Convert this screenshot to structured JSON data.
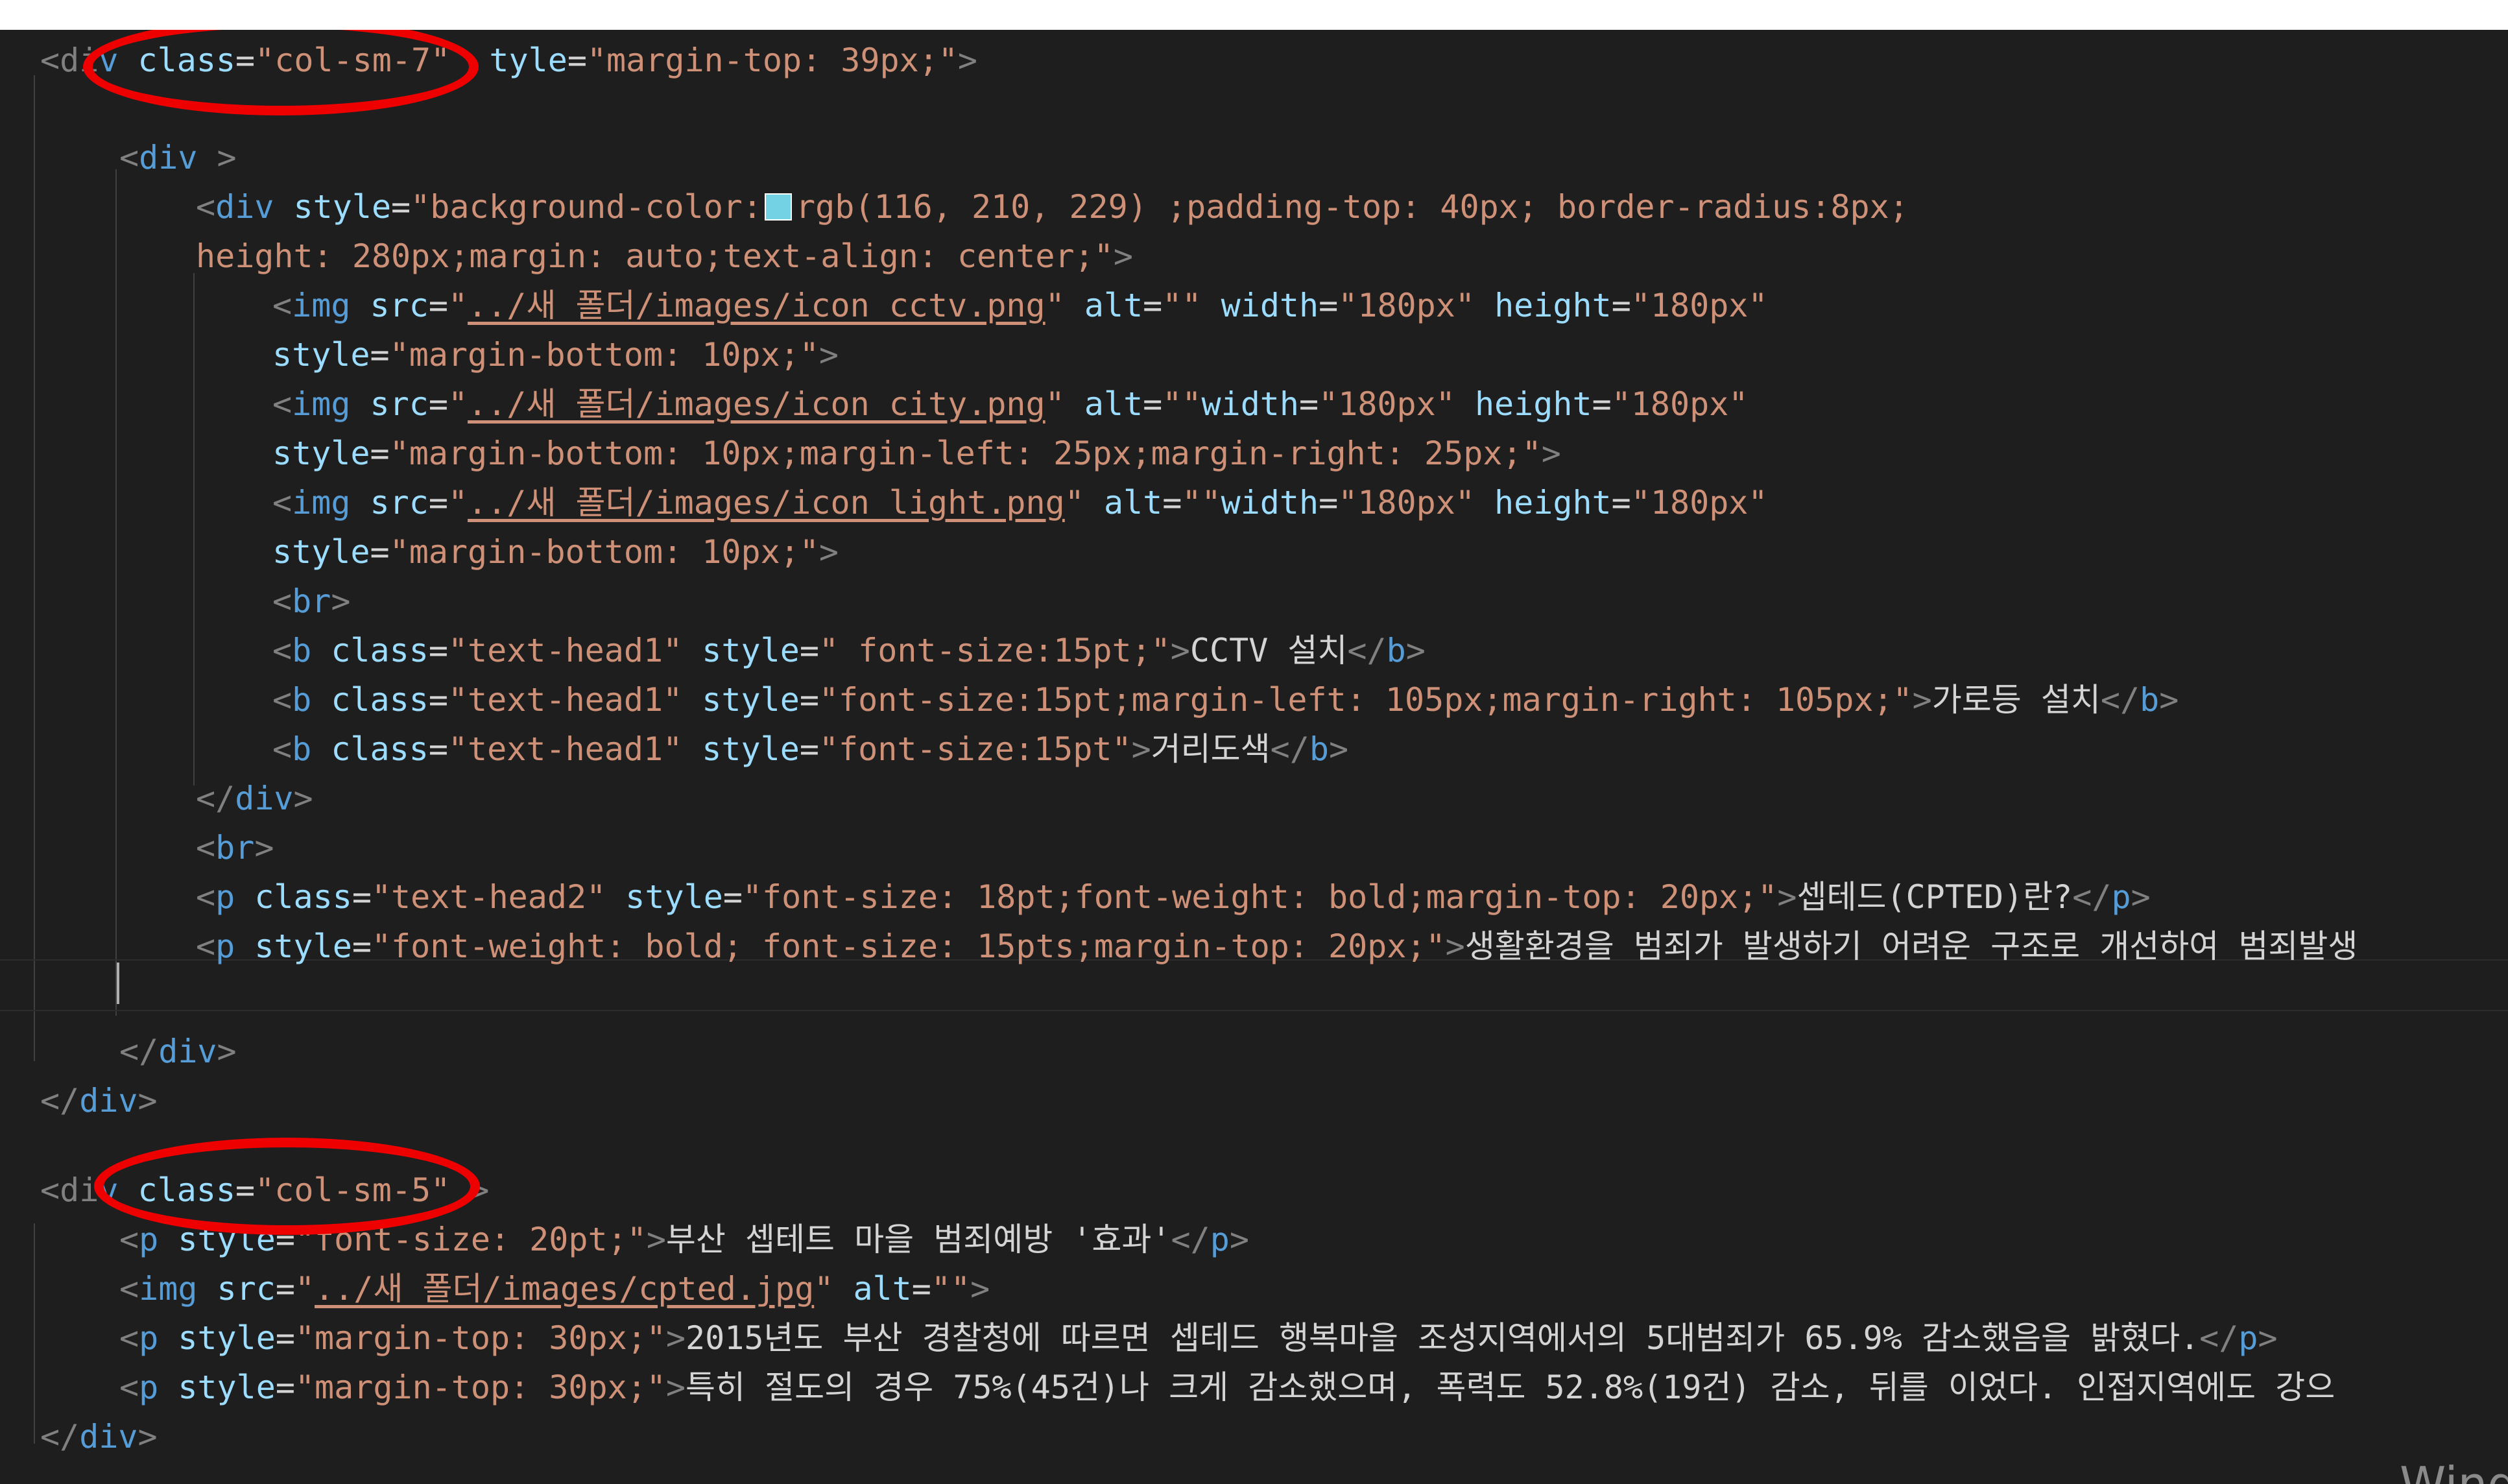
{
  "editor": {
    "swatch_color": "#74d2e5",
    "lines": {
      "l1": {
        "a": "<di",
        "b": "v ",
        "c": "class",
        "d": "=",
        "e": "\"col-sm-7\"",
        "f": "  ",
        "g": "tyle",
        "h": "=",
        "i": "\"margin-top: 39px;\"",
        "j": ">"
      },
      "l3": {
        "a": "<",
        "b": "div",
        "c": " >"
      },
      "l4": {
        "a": "<",
        "b": "div",
        "c": "style",
        "d": "=",
        "e": "\"background-color:",
        "f": "rgb(116, 210, 229) ;padding-top: 40px; border-radius:8px;"
      },
      "l5": {
        "a": "height: 280px;margin: auto;text-align: center;\"",
        "b": ">"
      },
      "l6": {
        "a": "<",
        "b": "img",
        "c": "src",
        "d": "=",
        "e": "\"",
        "f": "../새 폴더/images/icon_cctv.png",
        "g": "\"",
        "h": "alt",
        "i": "=",
        "j": "\"\"",
        "k": "width",
        "l": "=",
        "m": "\"180px\"",
        "n": "height",
        "o": "=",
        "p": "\"180px\""
      },
      "l7": {
        "a": "style",
        "b": "=",
        "c": "\"margin-bottom: 10px;\"",
        "d": ">"
      },
      "l8": {
        "a": "<",
        "b": "img",
        "c": "src",
        "d": "=",
        "e": "\"",
        "f": "../새 폴더/images/icon_city.png",
        "g": "\"",
        "h": "alt",
        "i": "=",
        "j": "\"\"",
        "k": "width",
        "l": "=",
        "m": "\"180px\"",
        "n": "height",
        "o": "=",
        "p": "\"180px\""
      },
      "l9": {
        "a": "style",
        "b": "=",
        "c": "\"margin-bottom: 10px;margin-left: 25px;margin-right: 25px;\"",
        "d": ">"
      },
      "l10": {
        "a": "<",
        "b": "img",
        "c": "src",
        "d": "=",
        "e": "\"",
        "f": "../새 폴더/images/icon_light.png",
        "g": "\"",
        "h": "alt",
        "i": "=",
        "j": "\"\"",
        "k": "width",
        "l": "=",
        "m": "\"180px\"",
        "n": "height",
        "o": "=",
        "p": "\"180px\""
      },
      "l11": {
        "a": "style",
        "b": "=",
        "c": "\"margin-bottom: 10px;\"",
        "d": ">"
      },
      "l12": {
        "a": "<",
        "b": "br",
        "c": ">"
      },
      "l13": {
        "a": "<",
        "b": "b",
        "c": "class",
        "d": "=",
        "e": "\"text-head1\"",
        "f": "style",
        "g": "=",
        "h": "\" font-size:15pt;\"",
        "i": ">",
        "j": "CCTV 설치",
        "k": "</",
        "l": "b",
        "m": ">"
      },
      "l14": {
        "a": "<",
        "b": "b",
        "c": "class",
        "d": "=",
        "e": "\"text-head1\"",
        "f": "style",
        "g": "=",
        "h": "\"font-size:15pt;margin-left: 105px;margin-right: 105px;\"",
        "i": ">",
        "j": "가로등 설치",
        "k": "</",
        "l": "b",
        "m": ">"
      },
      "l15": {
        "a": "<",
        "b": "b",
        "c": "class",
        "d": "=",
        "e": "\"text-head1\"",
        "f": "style",
        "g": "=",
        "h": "\"font-size:15pt\"",
        "i": ">",
        "j": "거리도색",
        "k": "</",
        "l": "b",
        "m": ">"
      },
      "l16": {
        "a": "</",
        "b": "div",
        "c": ">"
      },
      "l17": {
        "a": "<",
        "b": "br",
        "c": ">"
      },
      "l18": {
        "a": "<",
        "b": "p",
        "c": "class",
        "d": "=",
        "e": "\"text-head2\"",
        "f": "style",
        "g": "=",
        "h": "\"font-size: 18pt;font-weight: bold;margin-top: 20px;\"",
        "i": ">",
        "j": "셉테드(CPTED)란?",
        "k": "</",
        "l": "p",
        "m": ">"
      },
      "l19": {
        "a": "<",
        "b": "p",
        "c": "style",
        "d": "=",
        "e": "\"font-weight: bold; font-size: 15pts;margin-top: 20px;\"",
        "f": ">",
        "g": "생활환경을 범죄가 발생하기 어려운 구조로 개선하여 범죄발생"
      },
      "l21": {
        "a": "</",
        "b": "div",
        "c": ">"
      },
      "l22": {
        "a": "</",
        "b": "div",
        "c": ">"
      },
      "l24": {
        "a": "<di",
        "b": "v ",
        "c": "class",
        "d": "=",
        "e": "\"col-sm-5\"",
        "f": " >"
      },
      "l25": {
        "a": "<",
        "b": "p",
        "c": "style",
        "d": "=",
        "e": "\"font-size: 20pt;\"",
        "f": ">",
        "g": "부산 셉테트 마을 범죄예방 '효과'",
        "h": "</",
        "i": "p",
        "j": ">"
      },
      "l26": {
        "a": "<",
        "b": "img",
        "c": "src",
        "d": "=",
        "e": "\"",
        "f": "../새 폴더/images/cpted.jpg",
        "g": "\"",
        "h": "alt",
        "i": "=",
        "j": "\"\"",
        "k": ">"
      },
      "l27": {
        "a": "<",
        "b": "p",
        "c": "style",
        "d": "=",
        "e": "\"margin-top: 30px;\"",
        "f": ">",
        "g": "2015년도 부산 경찰청에 따르면 셉테드 행복마을 조성지역에서의 5대범죄가 65.9% 감소했음을 밝혔다.",
        "h": "</",
        "i": "p",
        "j": ">"
      },
      "l28": {
        "a": "<",
        "b": "p",
        "c": "style",
        "d": "=",
        "e": "\"margin-top: 30px;\"",
        "f": ">",
        "g": "특히 절도의 경우 75%(45건)나 크게 감소했으며, 폭력도 52.8%(19건) 감소, 뒤를 이었다. 인접지역에도 강으"
      },
      "l29": {
        "a": "</",
        "b": "div",
        "c": ">"
      }
    }
  },
  "watermark": "Wind"
}
